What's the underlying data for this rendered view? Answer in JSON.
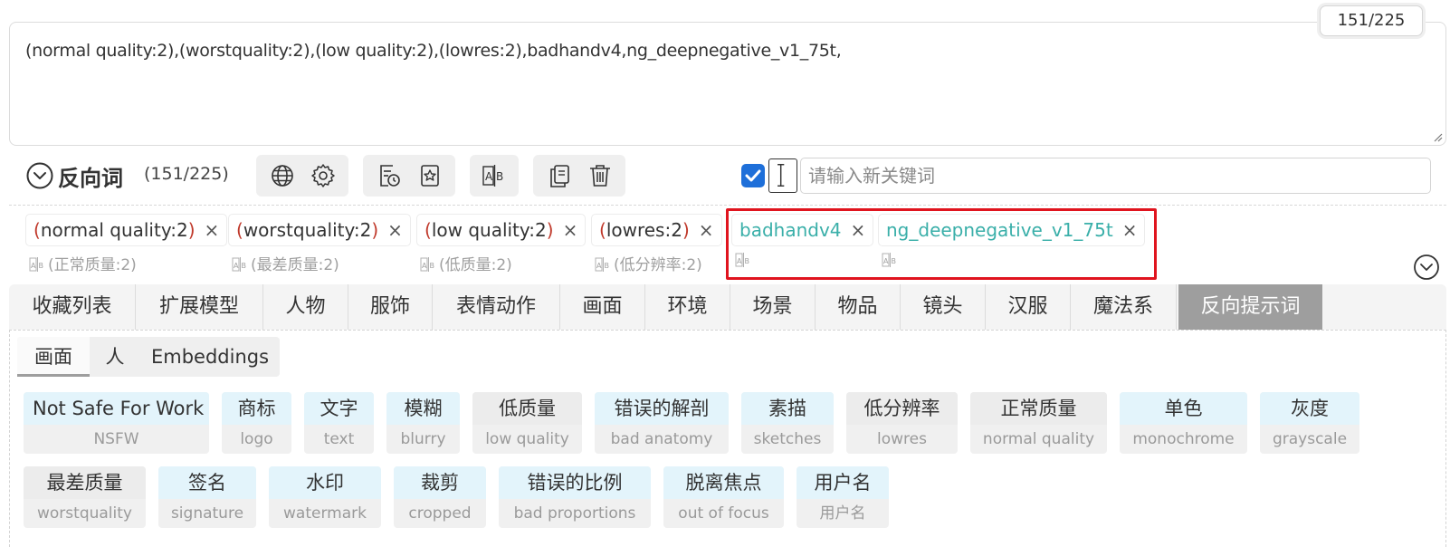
{
  "prompt": {
    "text": "(normal quality:2),(worstquality:2),(low quality:2),(lowres:2),badhandv4,ng_deepnegative_v1_75t,",
    "token_count": "151/225"
  },
  "toolbar": {
    "title": "反向词",
    "count": "(151/225)",
    "keyword_placeholder": "请输入新关键词",
    "auto_translate_checked": true
  },
  "tags": [
    {
      "open": "(",
      "text": "normal quality:2",
      "close": ")",
      "translation": "(正常质量:2)"
    },
    {
      "open": "(",
      "text": "worstquality:2",
      "close": ")",
      "translation": "(最差质量:2)"
    },
    {
      "open": "(",
      "text": "low quality:2",
      "close": ")",
      "translation": "(低质量:2)"
    },
    {
      "open": "(",
      "text": "lowres:2",
      "close": ")",
      "translation": "(低分辨率:2)"
    },
    {
      "text": "badhandv4",
      "translation": ""
    },
    {
      "text": "ng_deepnegative_v1_75t",
      "translation": ""
    }
  ],
  "close_glyph": "×",
  "category_tabs": [
    "收藏列表",
    "扩展模型",
    "人物",
    "服饰",
    "表情动作",
    "画面",
    "环境",
    "场景",
    "物品",
    "镜头",
    "汉服",
    "魔法系",
    "反向提示词"
  ],
  "active_category": "反向提示词",
  "sub_tabs": [
    "画面",
    "人",
    "Embeddings"
  ],
  "active_sub_tab": "画面",
  "keywords": [
    {
      "zh": "Not Safe For Work",
      "en": "NSFW",
      "style": "blue"
    },
    {
      "zh": "商标",
      "en": "logo",
      "style": "blue"
    },
    {
      "zh": "文字",
      "en": "text",
      "style": "blue"
    },
    {
      "zh": "模糊",
      "en": "blurry",
      "style": "blue"
    },
    {
      "zh": "低质量",
      "en": "low quality",
      "style": "gray"
    },
    {
      "zh": "错误的解剖",
      "en": "bad anatomy",
      "style": "blue"
    },
    {
      "zh": "素描",
      "en": "sketches",
      "style": "blue"
    },
    {
      "zh": "低分辨率",
      "en": "lowres",
      "style": "gray"
    },
    {
      "zh": "正常质量",
      "en": "normal quality",
      "style": "gray"
    },
    {
      "zh": "单色",
      "en": "monochrome",
      "style": "blue"
    },
    {
      "zh": "灰度",
      "en": "grayscale",
      "style": "blue"
    },
    {
      "zh": "最差质量",
      "en": "worstquality",
      "style": "gray"
    },
    {
      "zh": "签名",
      "en": "signature",
      "style": "blue"
    },
    {
      "zh": "水印",
      "en": "watermark",
      "style": "blue"
    },
    {
      "zh": "裁剪",
      "en": "cropped",
      "style": "blue"
    },
    {
      "zh": "错误的比例",
      "en": "bad proportions",
      "style": "blue"
    },
    {
      "zh": "脱离焦点",
      "en": "out of focus",
      "style": "blue"
    },
    {
      "zh": "用户名",
      "en": "用户名",
      "style": "blue"
    }
  ],
  "colors": {
    "highlight_border": "#e0141e",
    "teal_tag": "#3aafa9",
    "paren_red": "#c0392b",
    "checkbox_blue": "#1e6fd9",
    "active_tab_bg": "#9e9e9e",
    "keyword_blue_bg": "#e3f4fb"
  }
}
